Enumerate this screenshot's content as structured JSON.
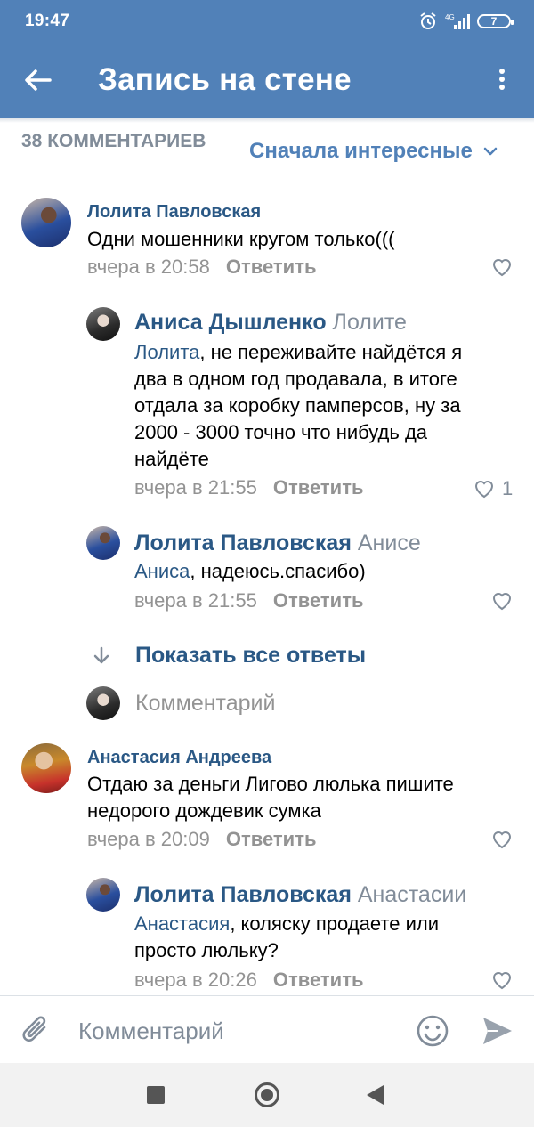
{
  "status_bar": {
    "time": "19:47",
    "network": "4G",
    "battery": "7"
  },
  "app_bar": {
    "title": "Запись на стене"
  },
  "comments_header": {
    "count_label": "38 КОММЕНТАРИЕВ",
    "sort_label": "Сначала интересные"
  },
  "comments": [
    {
      "author": "Лолита Павловская",
      "text": "Одни мошенники  кругом только(((",
      "time": "вчера в 20:58",
      "reply_label": "Ответить",
      "likes": ""
    },
    {
      "author": "Аниса Дышленко",
      "reply_to": "Лолите",
      "mention": "Лолита",
      "text_rest": ", не переживайте найдётся я два в одном год продавала, в итоге отдала за коробку памперсов, ну за 2000 - 3000 точно что нибудь да найдёте",
      "time": "вчера в 21:55",
      "reply_label": "Ответить",
      "likes": "1"
    },
    {
      "author": "Лолита Павловская",
      "reply_to": "Анисе",
      "mention": "Аниса",
      "text_rest": ", надеюсь.спасибо)",
      "time": "вчера в 21:55",
      "reply_label": "Ответить",
      "likes": ""
    },
    {
      "author": "Анастасия Андреева",
      "text": "Отдаю за деньги Лигово люлька пишите недорого дождевик сумка",
      "time": "вчера в 20:09",
      "reply_label": "Ответить",
      "likes": ""
    },
    {
      "author": "Лолита Павловская",
      "reply_to": "Анастасии",
      "mention": "Анастасия",
      "text_rest": ", коляску продаете или просто люльку?",
      "time": "вчера в 20:26",
      "reply_label": "Ответить",
      "likes": ""
    }
  ],
  "show_all_replies": "Показать все ответы",
  "inline_reply_placeholder": "Комментарий",
  "composer": {
    "placeholder": "Комментарий"
  },
  "colors": {
    "header_bg": "#5181b8",
    "link": "#2a5885",
    "muted": "#939393"
  },
  "icons": [
    "back-arrow-icon",
    "more-vertical-icon",
    "alarm-icon",
    "signal-icon",
    "battery-icon",
    "chevron-down-icon",
    "heart-icon",
    "arrow-down-icon",
    "attach-icon",
    "emoji-icon",
    "send-icon"
  ]
}
